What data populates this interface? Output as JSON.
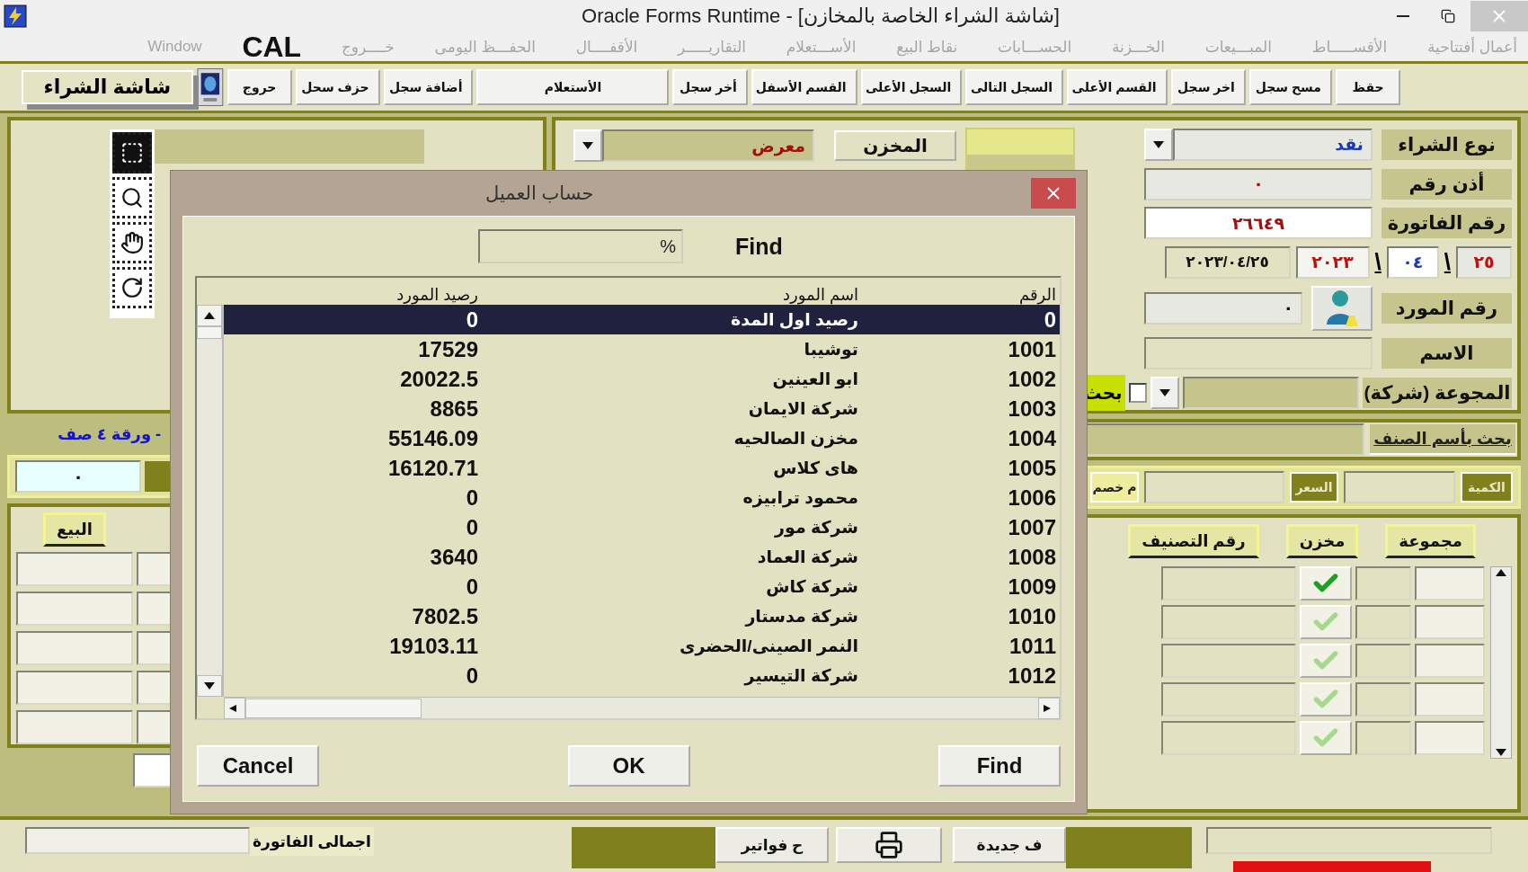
{
  "window": {
    "title": "Oracle Forms Runtime - [شاشة الشراء الخاصة بالمخازن]"
  },
  "menu": [
    {
      "label": "أعمال أفتتاحية",
      "disabled": true
    },
    {
      "label": "الأقســـــاط",
      "disabled": true
    },
    {
      "label": "المبـــيعات",
      "disabled": true
    },
    {
      "label": "الخـــزنة",
      "disabled": true
    },
    {
      "label": "الحســـابات",
      "disabled": true
    },
    {
      "label": "نقاط البيع",
      "disabled": true
    },
    {
      "label": "الأســـتعلام",
      "disabled": true
    },
    {
      "label": "التقاريـــــر",
      "disabled": true
    },
    {
      "label": "الأقفــــال",
      "disabled": true
    },
    {
      "label": "الحفـــظ اليومى",
      "disabled": true
    },
    {
      "label": "خــــروج",
      "disabled": true
    }
  ],
  "cal_label": "CAL",
  "window_menu": {
    "label": "Window",
    "disabled": true
  },
  "toolbar": {
    "buttons": [
      {
        "label": "حقظ",
        "kind": "normal"
      },
      {
        "label": "مسح سجل",
        "kind": "normal"
      },
      {
        "label": "اخر سجل",
        "kind": "normal"
      },
      {
        "label": "القسم الأعلى",
        "kind": "normal"
      },
      {
        "label": "السجل التالى",
        "kind": "normal"
      },
      {
        "label": "السجل الأعلى",
        "kind": "normal"
      },
      {
        "label": "القسم الأسفل",
        "kind": "normal"
      },
      {
        "label": "أخر سجل",
        "kind": "normal"
      },
      {
        "label": "الأستعلام",
        "kind": "wide"
      },
      {
        "label": "أضافة سجل",
        "kind": "normal"
      },
      {
        "label": "حزف سحل",
        "kind": "normal"
      },
      {
        "label": "حروج",
        "kind": "normal"
      }
    ],
    "screen_label": "شاشة الشراء"
  },
  "store": {
    "button": "المخزن",
    "value": "معرض"
  },
  "purchase_type": {
    "label": "نوع الشراء",
    "value": "نقد"
  },
  "permit_no": {
    "label": "أذن رقم",
    "value": "٠"
  },
  "invoice_no": {
    "label": "رقم الفاتورة",
    "value": "٢٦٦٤٩"
  },
  "date": {
    "day": "٢٥",
    "month": "٠٤",
    "year": "٢٠٢٣",
    "full": "٢٠٢٣/٠٤/٢٥",
    "separators": [
      "\\",
      "\\"
    ]
  },
  "supplier_no": {
    "label": "رقم المورد",
    "value": "٠"
  },
  "name": {
    "label": "الاسم"
  },
  "group": {
    "label": "المجوعة (شركة)",
    "search_label": "بحث",
    "search_checked": false
  },
  "item_search": {
    "label": "بحث بأسم الصنف"
  },
  "item_entry": {
    "quantity_label": "الكمية",
    "price_label": "السعر",
    "discount_label": "م خصم"
  },
  "items_grid": {
    "columns": [
      "مجموعة",
      "مخزن",
      "رقم التصنيف"
    ],
    "rows": [
      {
        "selected": true
      },
      {
        "selected": false
      },
      {
        "selected": false
      },
      {
        "selected": false
      },
      {
        "selected": false
      }
    ]
  },
  "sheet_info": "- ورقة ٤ صف",
  "left_field_value": "٠",
  "sale_column": "البيع",
  "bottom": {
    "total_label": "اجمالى الفاتورة",
    "invoices_button": "ح فواتير",
    "new_button": "ف جديدة"
  },
  "dialog": {
    "title": "حساب العميل",
    "find_label": "Find",
    "find_value": "%",
    "columns": [
      "الرقم",
      "اسم المورد",
      "رصيد المورد"
    ],
    "rows": [
      {
        "number": "0",
        "name": "رصيد اول المدة",
        "balance": "0",
        "selected": true
      },
      {
        "number": "1001",
        "name": "توشيبا",
        "balance": "17529",
        "selected": false
      },
      {
        "number": "1002",
        "name": "ابو العينين",
        "balance": "20022.5",
        "selected": false
      },
      {
        "number": "1003",
        "name": "شركة الايمان",
        "balance": "8865",
        "selected": false
      },
      {
        "number": "1004",
        "name": "مخزن الصالحيه",
        "balance": "55146.09",
        "selected": false
      },
      {
        "number": "1005",
        "name": "هاى كلاس",
        "balance": "16120.71",
        "selected": false
      },
      {
        "number": "1006",
        "name": "محمود ترابيزه",
        "balance": "0",
        "selected": false
      },
      {
        "number": "1007",
        "name": "شركة مور",
        "balance": "0",
        "selected": false
      },
      {
        "number": "1008",
        "name": "شركة العماد",
        "balance": "3640",
        "selected": false
      },
      {
        "number": "1009",
        "name": "شركة كاش",
        "balance": "0",
        "selected": false
      },
      {
        "number": "1010",
        "name": "شركة مدستار",
        "balance": "7802.5",
        "selected": false
      },
      {
        "number": "1011",
        "name": "النمر الصينى/الحضرى",
        "balance": "19103.11",
        "selected": false
      },
      {
        "number": "1012",
        "name": "شركة التيسير",
        "balance": "0",
        "selected": false
      }
    ],
    "buttons": [
      "Find",
      "OK",
      "Cancel"
    ]
  }
}
